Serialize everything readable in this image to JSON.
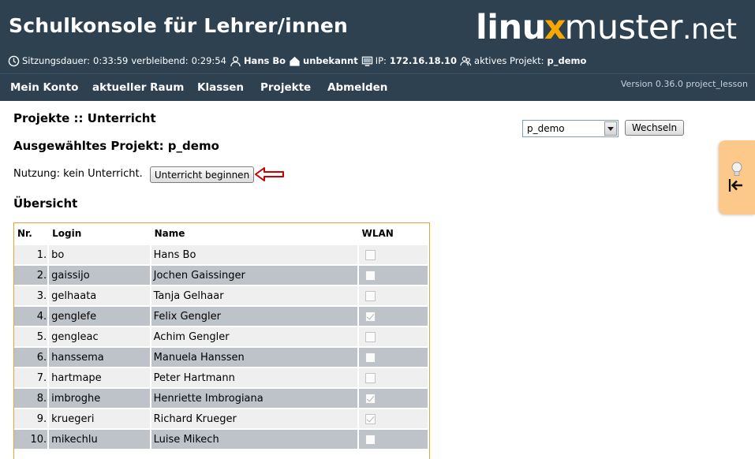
{
  "header": {
    "title": "Schulkonsole für Lehrer/innen",
    "logo": {
      "part1": "linu",
      "part2": "x",
      "part3": "muster",
      "part4": ".net"
    },
    "status": {
      "session_label": "Sitzungsdauer:",
      "session_value": "0:33:59",
      "remaining_label": "verbleibend:",
      "remaining_value": "0:29:54",
      "user": "Hans Bo",
      "room": "unbekannt",
      "ip_label": "IP:",
      "ip_value": "172.16.18.10",
      "project_label": "aktives Projekt:",
      "project_value": "p_demo"
    }
  },
  "nav": {
    "items": [
      "Mein Konto",
      "aktueller Raum",
      "Klassen",
      "Projekte",
      "Abmelden"
    ],
    "version": "Version 0.36.0 project_lesson"
  },
  "main": {
    "breadcrumb": "Projekte :: Unterricht",
    "selected_project": "Ausgewähltes Projekt: p_demo",
    "usage_text": "Nutzung: kein Unterricht.",
    "start_button": "Unterricht beginnen",
    "overview_heading": "Übersicht",
    "project_select_value": "p_demo",
    "switch_button": "Wechseln"
  },
  "table": {
    "headers": [
      "Nr.",
      "Login",
      "Name",
      "WLAN"
    ],
    "rows": [
      {
        "nr": "1.",
        "login": "bo",
        "name": "Hans Bo",
        "wlan": false
      },
      {
        "nr": "2.",
        "login": "gaissijo",
        "name": "Jochen Gaissinger",
        "wlan": false
      },
      {
        "nr": "3.",
        "login": "gelhaata",
        "name": "Tanja Gelhaar",
        "wlan": false
      },
      {
        "nr": "4.",
        "login": "genglefe",
        "name": "Felix Gengler",
        "wlan": true
      },
      {
        "nr": "5.",
        "login": "gengleac",
        "name": "Achim Gengler",
        "wlan": false
      },
      {
        "nr": "6.",
        "login": "hanssema",
        "name": "Manuela Hanssen",
        "wlan": false
      },
      {
        "nr": "7.",
        "login": "hartmape",
        "name": "Peter Hartmann",
        "wlan": false
      },
      {
        "nr": "8.",
        "login": "imbroghe",
        "name": "Henriette Imbrogiana",
        "wlan": true
      },
      {
        "nr": "9.",
        "login": "kruegeri",
        "name": "Richard Krueger",
        "wlan": true
      },
      {
        "nr": "10.",
        "login": "mikechlu",
        "name": "Luise Mikech",
        "wlan": false
      }
    ]
  },
  "colors": {
    "header_bg": "#2e4150",
    "logo_accent": "#f6a800",
    "table_border": "#f0a030",
    "row_dark": "#bdc3c9",
    "row_light": "#efefef",
    "side_panel": "#fcc98a",
    "arrow": "#cc0000"
  },
  "icons": [
    "clock-icon",
    "user-icon",
    "room-icon",
    "monitor-icon",
    "project-icon",
    "lightbulb-icon",
    "collapse-arrow-icon",
    "chevron-down-icon",
    "red-arrow-icon"
  ]
}
